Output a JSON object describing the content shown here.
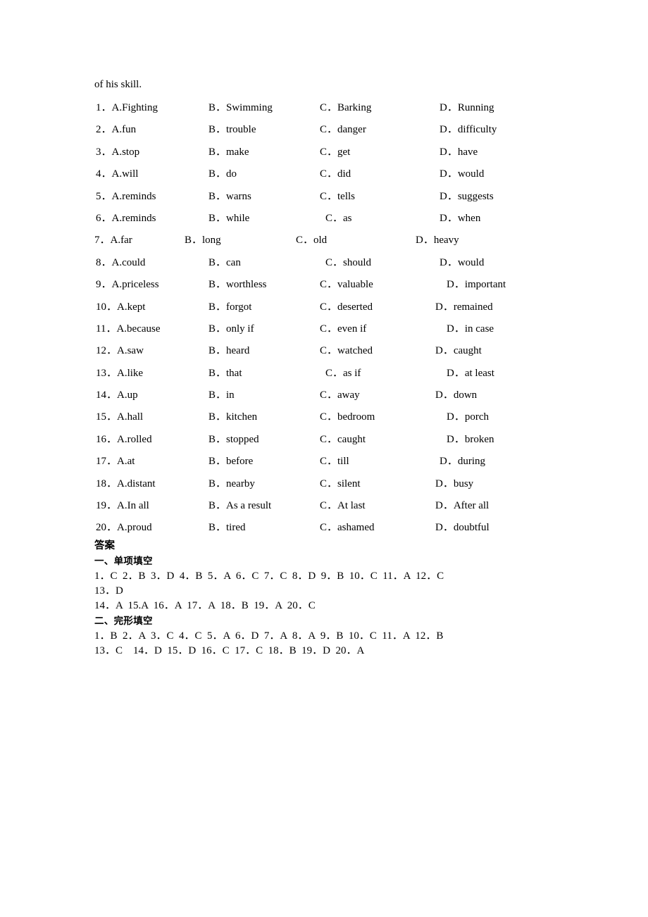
{
  "document": {
    "carry_over_line": "of his skill.",
    "answers_label": "答案"
  },
  "options": {
    "rows": [
      {
        "num": "1．",
        "a": "A.Fighting",
        "b": "B．Swimming",
        "c": "C．Barking",
        "d": "D．Running"
      },
      {
        "num": "2．",
        "a": "A.fun",
        "b": "B．trouble",
        "c": "C．danger",
        "d": "D．difficulty"
      },
      {
        "num": "3．",
        "a": "A.stop",
        "b": "B．make",
        "c": "C．get",
        "d": "D．have"
      },
      {
        "num": "4．",
        "a": "A.will",
        "b": "B．do",
        "c": "C．did",
        "d": "D．would"
      },
      {
        "num": "5．",
        "a": "A.reminds",
        "b": "B．warns",
        "c": "C．tells",
        "d": "D．suggests"
      },
      {
        "num": "6．",
        "a": "A.reminds",
        "b": "B．while",
        "c": "C．as",
        "d": "D．when"
      },
      {
        "num": "7．",
        "a": "A.far",
        "b": "B．long",
        "c": "C．old",
        "d": "D．heavy"
      },
      {
        "num": "8．",
        "a": "A.could",
        "b": "B．can",
        "c": "C．should",
        "d": "D．would"
      },
      {
        "num": "9．",
        "a": "A.priceless",
        "b": "B．worthless",
        "c": "C．valuable",
        "d": "D．important"
      },
      {
        "num": "10．",
        "a": "A.kept",
        "b": "B．forgot",
        "c": "C．deserted",
        "d": "D．remained"
      },
      {
        "num": "11．",
        "a": "A.because",
        "b": "B．only if",
        "c": "C．even if",
        "d": "D．in case"
      },
      {
        "num": "12．",
        "a": "A.saw",
        "b": "B．heard",
        "c": "C．watched",
        "d": "D．caught"
      },
      {
        "num": "13．",
        "a": "A.like",
        "b": "B．that",
        "c": "C．as if",
        "d": "D．at least"
      },
      {
        "num": "14．",
        "a": "A.up",
        "b": "B．in",
        "c": "C．away",
        "d": "D．down"
      },
      {
        "num": "15．",
        "a": "A.hall",
        "b": "B．kitchen",
        "c": "C．bedroom",
        "d": "D．porch"
      },
      {
        "num": "16．",
        "a": "A.rolled",
        "b": "B．stopped",
        "c": "C．caught",
        "d": "D．broken"
      },
      {
        "num": "17．",
        "a": "A.at",
        "b": "B．before",
        "c": "C．till",
        "d": "D．during"
      },
      {
        "num": "18．",
        "a": "A.distant",
        "b": "B．nearby",
        "c": "C．silent",
        "d": "D．busy"
      },
      {
        "num": "19．",
        "a": "A.In all",
        "b": "B．As a result",
        "c": "C．At last",
        "d": "D．After all"
      },
      {
        "num": "20．",
        "a": "A.proud",
        "b": "B．tired",
        "c": "C．ashamed",
        "d": "D．doubtful"
      }
    ]
  },
  "answer_key": {
    "sections": [
      {
        "heading": "一、单项填空",
        "lines": [
          "1．C  2．B  3．D  4．B  5．A  6．C  7．C  8．D  9．B  10．C  11．A  12．C",
          "13．D",
          "14．A  15.A  16．A  17．A  18．B  19．A  20．C"
        ]
      },
      {
        "heading": "二、完形填空",
        "lines": [
          "1．B  2．A  3．C  4．C  5．A  6．D  7．A  8．A  9．B  10．C  11．A  12．B",
          "13．C    14．D  15．D  16．C  17．C  18．B  19．D  20．A"
        ]
      }
    ]
  }
}
